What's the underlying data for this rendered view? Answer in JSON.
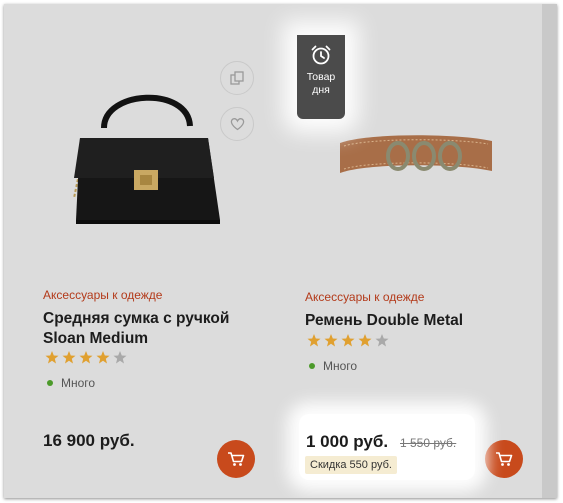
{
  "products": [
    {
      "category": "Аксессуары к одежде",
      "title_line1": "Средняя сумка с ручкой",
      "title_line2": "Sloan Medium",
      "rating": 4,
      "rating_max": 5,
      "stock": "Много",
      "price": "16 900 руб."
    },
    {
      "category": "Аксессуары к одежде",
      "title_line1": "Ремень Double Metal",
      "rating": 4,
      "rating_max": 5,
      "stock": "Много",
      "price": "1 000 руб.",
      "old_price": "1 550 руб.",
      "discount": "Скидка 550 руб."
    }
  ],
  "deal_badge": {
    "line1": "Товар",
    "line2": "дня",
    "icon": "alarm-clock-icon"
  },
  "icons": {
    "compare": "compare-icon",
    "favorite": "heart-icon",
    "cart": "cart-icon"
  },
  "colors": {
    "accent": "#c84a1c",
    "category": "#b33a1a",
    "star": "#e0a030",
    "stock_dot": "#4c9a2a"
  }
}
